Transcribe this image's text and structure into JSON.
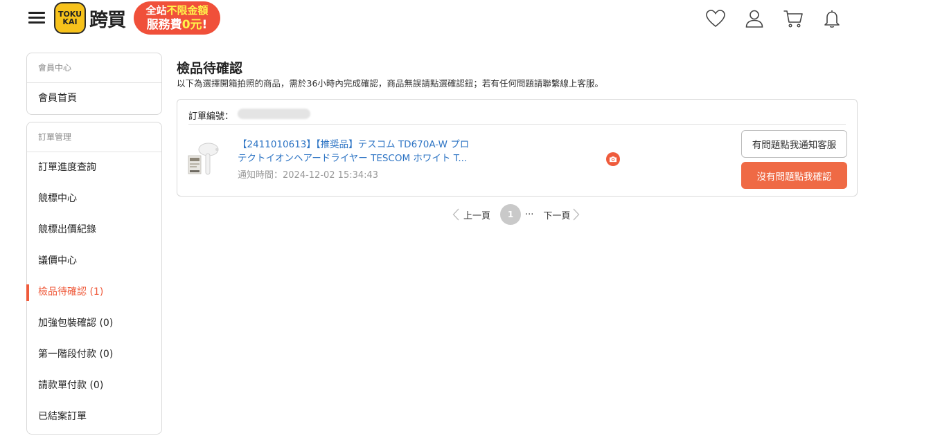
{
  "header": {
    "logo_badge_top": "TOKU",
    "logo_badge_bottom": "KAI",
    "logo_text": "跨買",
    "promo_line1_a": "全站",
    "promo_line1_b": "不限金額",
    "promo_line2_a": "服務費",
    "promo_line2_b": "0元",
    "promo_line2_c": "!",
    "icons": [
      "heart-icon",
      "user-icon",
      "cart-icon",
      "bell-icon"
    ]
  },
  "sidebar": {
    "member_section": {
      "heading": "會員中心",
      "items": [
        {
          "label": "會員首頁"
        }
      ]
    },
    "order_section": {
      "heading": "訂單管理",
      "items": [
        {
          "label": "訂單進度查詢"
        },
        {
          "label": "競標中心"
        },
        {
          "label": "競標出價紀錄"
        },
        {
          "label": "議價中心"
        },
        {
          "label": "檢品待確認 (1)",
          "active": true
        },
        {
          "label": "加強包裝確認 (0)"
        },
        {
          "label": "第一階段付款 (0)"
        },
        {
          "label": "請款單付款 (0)"
        },
        {
          "label": "已結案訂單"
        }
      ]
    }
  },
  "main": {
    "title": "檢品待確認",
    "description": "以下為選擇開箱拍照的商品，需於36小時內完成確認，商品無誤請點選確認鈕；若有任何問題請聯繫線上客服。",
    "order": {
      "order_no_label": "訂單編號：",
      "product_name_line1": "【2411010613】【推奨品】テスコム TD670A-W プロ",
      "product_name_line2": "テクトイオンヘアードライヤー TESCOM ホワイト T...",
      "notify_time": "通知時間：2024-12-02 15:34:43",
      "notify_button": "有問題點我通知客服",
      "confirm_button": "沒有問題點我確認"
    },
    "pagination": {
      "prev": "上一頁",
      "current_page": "1",
      "ellipsis": "···",
      "next": "下一頁"
    }
  },
  "colors": {
    "accent": "#ef5b3c",
    "link": "#2d74c4",
    "logo_yellow": "#f7c21b"
  }
}
